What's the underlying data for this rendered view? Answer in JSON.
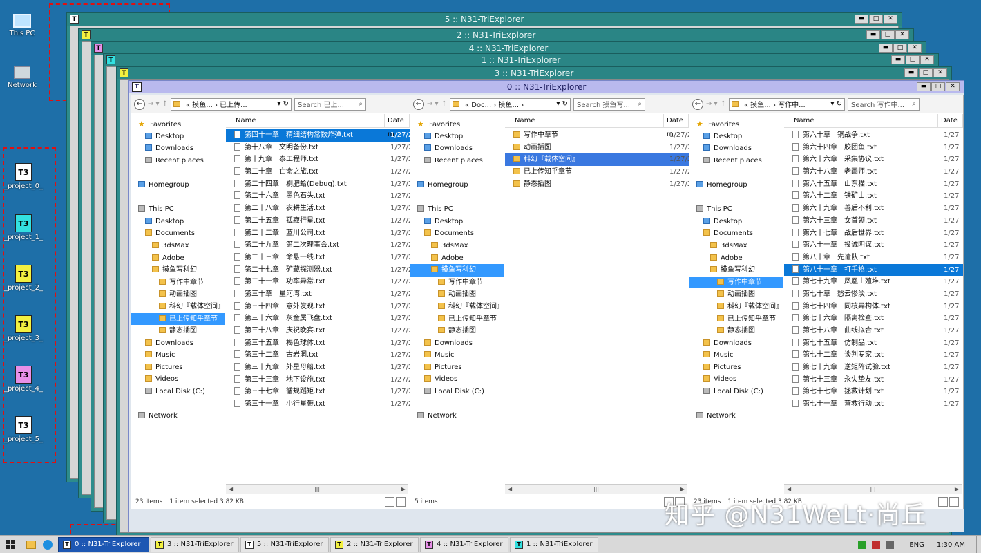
{
  "desktop": {
    "this_pc": "This PC",
    "network": "Network",
    "projects": [
      {
        "label": "_project_0_",
        "color": "#ffffff",
        "glyph": "T3"
      },
      {
        "label": "_project_1_",
        "color": "#33e0e0",
        "glyph": "T3"
      },
      {
        "label": "_project_2_",
        "color": "#f3f040",
        "glyph": "T3"
      },
      {
        "label": "_project_3_",
        "color": "#f3f040",
        "glyph": "T3"
      },
      {
        "label": "_project_4_",
        "color": "#e890e8",
        "glyph": "T3"
      },
      {
        "label": "_project_5_",
        "color": "#ffffff",
        "glyph": "T3"
      }
    ]
  },
  "bg_windows": [
    {
      "title": "5 :: N31-TriExplorer",
      "icon": "T",
      "color": "#ffffff"
    },
    {
      "title": "2 :: N31-TriExplorer",
      "icon": "T",
      "color": "#f3f040"
    },
    {
      "title": "4 :: N31-TriExplorer",
      "icon": "T",
      "color": "#e890e8"
    },
    {
      "title": "1 :: N31-TriExplorer",
      "icon": "T",
      "color": "#33e0e0"
    },
    {
      "title": "3 :: N31-TriExplorer",
      "icon": "T",
      "color": "#f3f040"
    }
  ],
  "win_buttons": {
    "min": "▬",
    "max": "□",
    "close": "✕"
  },
  "main": {
    "title": "0 :: N31-TriExplorer",
    "icon": "T",
    "panes": [
      {
        "address": "« 摸鱼... › 已上传...",
        "search": "Search 已上...",
        "header": {
          "name": "Name",
          "date": "Date m"
        },
        "nav": [
          {
            "label": "Favorites",
            "icon": "star",
            "indent": 0
          },
          {
            "label": "Desktop",
            "icon": "blue",
            "indent": 1
          },
          {
            "label": "Downloads",
            "icon": "blue",
            "indent": 1
          },
          {
            "label": "Recent places",
            "icon": "grey",
            "indent": 1
          },
          {
            "label": "",
            "icon": "",
            "indent": 0
          },
          {
            "label": "Homegroup",
            "icon": "blue",
            "indent": 0
          },
          {
            "label": "",
            "icon": "",
            "indent": 0
          },
          {
            "label": "This PC",
            "icon": "grey",
            "indent": 0
          },
          {
            "label": "Desktop",
            "icon": "blue",
            "indent": 1
          },
          {
            "label": "Documents",
            "icon": "folder",
            "indent": 1
          },
          {
            "label": "3dsMax",
            "icon": "folder",
            "indent": 2
          },
          {
            "label": "Adobe",
            "icon": "folder",
            "indent": 2
          },
          {
            "label": "摸鱼写科幻",
            "icon": "folder",
            "indent": 2
          },
          {
            "label": "写作中章节",
            "icon": "folder",
            "indent": 3
          },
          {
            "label": "动画插图",
            "icon": "folder",
            "indent": 3
          },
          {
            "label": "科幻『载体空间』",
            "icon": "folder",
            "indent": 3
          },
          {
            "label": "已上传知乎章节",
            "icon": "folder",
            "indent": 3,
            "selected": true
          },
          {
            "label": "静态插图",
            "icon": "folder",
            "indent": 3
          },
          {
            "label": "Downloads",
            "icon": "folder",
            "indent": 1
          },
          {
            "label": "Music",
            "icon": "folder",
            "indent": 1
          },
          {
            "label": "Pictures",
            "icon": "folder",
            "indent": 1
          },
          {
            "label": "Videos",
            "icon": "folder",
            "indent": 1
          },
          {
            "label": "Local Disk (C:)",
            "icon": "grey",
            "indent": 1
          },
          {
            "label": "",
            "icon": "",
            "indent": 0
          },
          {
            "label": "Network",
            "icon": "grey",
            "indent": 0
          }
        ],
        "files": [
          {
            "name": "第四十一章　精细结构常数炸弹.txt",
            "date": "1/27/2",
            "selected": true
          },
          {
            "name": "第十八章　文明备份.txt",
            "date": "1/27/2"
          },
          {
            "name": "第十九章　泰工程师.txt",
            "date": "1/27/2"
          },
          {
            "name": "第二十章　亡命之旅.txt",
            "date": "1/27/2"
          },
          {
            "name": "第二十四章　剔肥蛤(Debug).txt",
            "date": "1/27/2"
          },
          {
            "name": "第二十六章　黑色石头.txt",
            "date": "1/27/2"
          },
          {
            "name": "第二十八章　农耕生活.txt",
            "date": "1/27/2"
          },
          {
            "name": "第二十五章　孤寂行星.txt",
            "date": "1/27/2"
          },
          {
            "name": "第二十二章　蓝川公司.txt",
            "date": "1/27/2"
          },
          {
            "name": "第二十九章　第二次理事会.txt",
            "date": "1/27/2"
          },
          {
            "name": "第二十三章　命悬一线.txt",
            "date": "1/27/2"
          },
          {
            "name": "第二十七章　矿藏探测器.txt",
            "date": "1/27/2"
          },
          {
            "name": "第二十一章　功率异常.txt",
            "date": "1/27/2"
          },
          {
            "name": "第三十章　星河湾.txt",
            "date": "1/27/2"
          },
          {
            "name": "第三十四章　意外发现.txt",
            "date": "1/27/2"
          },
          {
            "name": "第三十六章　灰金属飞盘.txt",
            "date": "1/27/2"
          },
          {
            "name": "第三十八章　庆祝晚宴.txt",
            "date": "1/27/2"
          },
          {
            "name": "第三十五章　褐色球体.txt",
            "date": "1/27/2"
          },
          {
            "name": "第三十二章　古岩洞.txt",
            "date": "1/27/2"
          },
          {
            "name": "第三十九章　外星母船.txt",
            "date": "1/27/2"
          },
          {
            "name": "第三十三章　地下设施.txt",
            "date": "1/27/2"
          },
          {
            "name": "第三十七章　循规蹈矩.txt",
            "date": "1/27/2"
          },
          {
            "name": "第三十一章　小行星带.txt",
            "date": "1/27/2"
          }
        ],
        "status": {
          "count": "23 items",
          "selected": "1 item selected  3.82 KB"
        }
      },
      {
        "address": "« Doc... › 摸鱼... ›",
        "search": "Search 摸鱼写...",
        "header": {
          "name": "Name",
          "date": "Date m"
        },
        "nav": [
          {
            "label": "Favorites",
            "icon": "star",
            "indent": 0
          },
          {
            "label": "Desktop",
            "icon": "blue",
            "indent": 1
          },
          {
            "label": "Downloads",
            "icon": "blue",
            "indent": 1
          },
          {
            "label": "Recent places",
            "icon": "grey",
            "indent": 1
          },
          {
            "label": "",
            "icon": "",
            "indent": 0
          },
          {
            "label": "Homegroup",
            "icon": "blue",
            "indent": 0
          },
          {
            "label": "",
            "icon": "",
            "indent": 0
          },
          {
            "label": "This PC",
            "icon": "grey",
            "indent": 0
          },
          {
            "label": "Desktop",
            "icon": "blue",
            "indent": 1
          },
          {
            "label": "Documents",
            "icon": "folder",
            "indent": 1
          },
          {
            "label": "3dsMax",
            "icon": "folder",
            "indent": 2
          },
          {
            "label": "Adobe",
            "icon": "folder",
            "indent": 2
          },
          {
            "label": "摸鱼写科幻",
            "icon": "folder",
            "indent": 2,
            "selected": true
          },
          {
            "label": "写作中章节",
            "icon": "folder",
            "indent": 3
          },
          {
            "label": "动画插图",
            "icon": "folder",
            "indent": 3
          },
          {
            "label": "科幻『载体空间』",
            "icon": "folder",
            "indent": 3
          },
          {
            "label": "已上传知乎章节",
            "icon": "folder",
            "indent": 3
          },
          {
            "label": "静态插图",
            "icon": "folder",
            "indent": 3
          },
          {
            "label": "Downloads",
            "icon": "folder",
            "indent": 1
          },
          {
            "label": "Music",
            "icon": "folder",
            "indent": 1
          },
          {
            "label": "Pictures",
            "icon": "folder",
            "indent": 1
          },
          {
            "label": "Videos",
            "icon": "folder",
            "indent": 1
          },
          {
            "label": "Local Disk (C:)",
            "icon": "grey",
            "indent": 1
          },
          {
            "label": "",
            "icon": "",
            "indent": 0
          },
          {
            "label": "Network",
            "icon": "grey",
            "indent": 0
          }
        ],
        "files": [
          {
            "name": "写作中章节",
            "date": "1/27/2",
            "folder": true
          },
          {
            "name": "动画插图",
            "date": "1/27/2",
            "folder": true
          },
          {
            "name": "科幻『载体空间』",
            "date": "1/27/2",
            "folder": true,
            "selected": true
          },
          {
            "name": "已上传知乎章节",
            "date": "1/27/2",
            "folder": true
          },
          {
            "name": "静态插图",
            "date": "1/27/2",
            "folder": true
          }
        ],
        "status": {
          "count": "5 items",
          "selected": ""
        }
      },
      {
        "address": "« 摸鱼... › 写作中...",
        "search": "Search 写作中...",
        "header": {
          "name": "Name",
          "date": "Date"
        },
        "nav": [
          {
            "label": "Favorites",
            "icon": "star",
            "indent": 0
          },
          {
            "label": "Desktop",
            "icon": "blue",
            "indent": 1
          },
          {
            "label": "Downloads",
            "icon": "blue",
            "indent": 1
          },
          {
            "label": "Recent places",
            "icon": "grey",
            "indent": 1
          },
          {
            "label": "",
            "icon": "",
            "indent": 0
          },
          {
            "label": "Homegroup",
            "icon": "blue",
            "indent": 0
          },
          {
            "label": "",
            "icon": "",
            "indent": 0
          },
          {
            "label": "This PC",
            "icon": "grey",
            "indent": 0
          },
          {
            "label": "Desktop",
            "icon": "blue",
            "indent": 1
          },
          {
            "label": "Documents",
            "icon": "folder",
            "indent": 1
          },
          {
            "label": "3dsMax",
            "icon": "folder",
            "indent": 2
          },
          {
            "label": "Adobe",
            "icon": "folder",
            "indent": 2
          },
          {
            "label": "摸鱼写科幻",
            "icon": "folder",
            "indent": 2
          },
          {
            "label": "写作中章节",
            "icon": "folder",
            "indent": 3,
            "selected": true
          },
          {
            "label": "动画插图",
            "icon": "folder",
            "indent": 3
          },
          {
            "label": "科幻『载体空间』",
            "icon": "folder",
            "indent": 3
          },
          {
            "label": "已上传知乎章节",
            "icon": "folder",
            "indent": 3
          },
          {
            "label": "静态插图",
            "icon": "folder",
            "indent": 3
          },
          {
            "label": "Downloads",
            "icon": "folder",
            "indent": 1
          },
          {
            "label": "Music",
            "icon": "folder",
            "indent": 1
          },
          {
            "label": "Pictures",
            "icon": "folder",
            "indent": 1
          },
          {
            "label": "Videos",
            "icon": "folder",
            "indent": 1
          },
          {
            "label": "Local Disk (C:)",
            "icon": "grey",
            "indent": 1
          },
          {
            "label": "",
            "icon": "",
            "indent": 0
          },
          {
            "label": "Network",
            "icon": "grey",
            "indent": 0
          }
        ],
        "files": [
          {
            "name": "第六十章　铜战争.txt",
            "date": "1/27"
          },
          {
            "name": "第六十四章　胶团鱼.txt",
            "date": "1/27"
          },
          {
            "name": "第六十六章　采集协议.txt",
            "date": "1/27"
          },
          {
            "name": "第六十八章　老画师.txt",
            "date": "1/27"
          },
          {
            "name": "第六十五章　山东猫.txt",
            "date": "1/27"
          },
          {
            "name": "第六十二章　铁矿山.txt",
            "date": "1/27"
          },
          {
            "name": "第六十九章　善后不利.txt",
            "date": "1/27"
          },
          {
            "name": "第六十三章　女首领.txt",
            "date": "1/27"
          },
          {
            "name": "第六十七章　战后世界.txt",
            "date": "1/27"
          },
          {
            "name": "第六十一章　投诚阴谋.txt",
            "date": "1/27"
          },
          {
            "name": "第八十章　先遣队.txt",
            "date": "1/27"
          },
          {
            "name": "第八十一章　打手枪.txt",
            "date": "1/27",
            "selected": true
          },
          {
            "name": "第七十九章　凤凰山殖堆.txt",
            "date": "1/27"
          },
          {
            "name": "第七十章　愁云惨淡.txt",
            "date": "1/27"
          },
          {
            "name": "第七十四章　同核异构体.txt",
            "date": "1/27"
          },
          {
            "name": "第七十六章　隔离检查.txt",
            "date": "1/27"
          },
          {
            "name": "第七十八章　曲线拟合.txt",
            "date": "1/27"
          },
          {
            "name": "第七十五章　仿制品.txt",
            "date": "1/27"
          },
          {
            "name": "第七十二章　谈判专家.txt",
            "date": "1/27"
          },
          {
            "name": "第七十九章　逆矩阵试验.txt",
            "date": "1/27"
          },
          {
            "name": "第七十三章　永失挚友.txt",
            "date": "1/27"
          },
          {
            "name": "第七十七章　拯救计划.txt",
            "date": "1/27"
          },
          {
            "name": "第七十一章　营救行动.txt",
            "date": "1/27"
          }
        ],
        "status": {
          "count": "23 items",
          "selected": "1 item selected  3.82 KB"
        }
      }
    ]
  },
  "taskbar": {
    "items": [
      {
        "label": "0 :: N31-TriExplorer",
        "color": "#ffffff",
        "active": true
      },
      {
        "label": "3 :: N31-TriExplorer",
        "color": "#f3f040"
      },
      {
        "label": "5 :: N31-TriExplorer",
        "color": "#ffffff"
      },
      {
        "label": "2 :: N31-TriExplorer",
        "color": "#f3f040"
      },
      {
        "label": "4 :: N31-TriExplorer",
        "color": "#e890e8"
      },
      {
        "label": "1 :: N31-TriExplorer",
        "color": "#33e0e0"
      }
    ],
    "lang": "ENG",
    "time": "1:30 AM"
  },
  "watermark": "知乎 @N31WeLt·尚丘"
}
